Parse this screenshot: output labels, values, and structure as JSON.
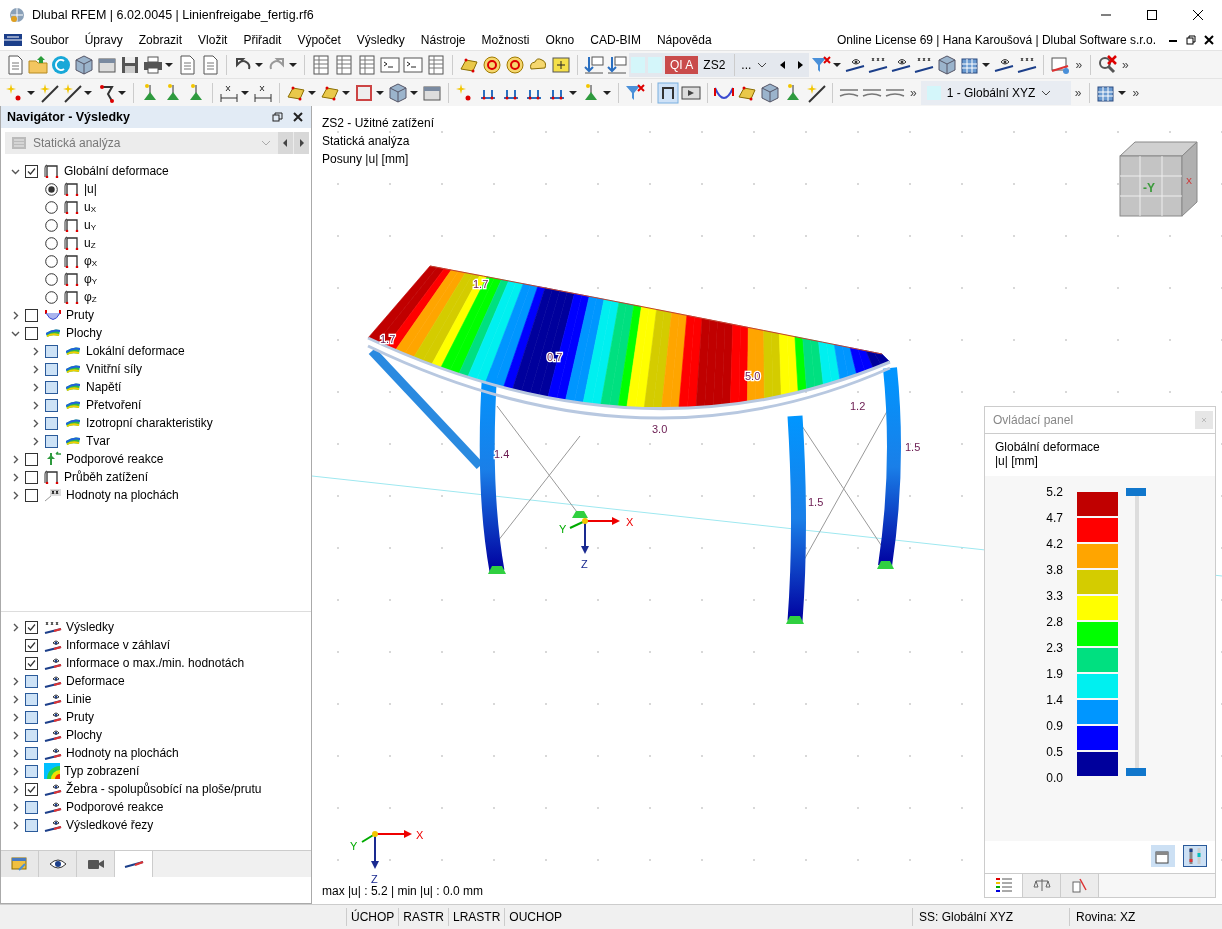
{
  "window": {
    "title": "Dlubal RFEM | 6.02.0045 | Linienfreigabe_fertig.rf6"
  },
  "menu": {
    "items": [
      "Soubor",
      "Úpravy",
      "Zobrazit",
      "Vložit",
      "Přiřadit",
      "Výpočet",
      "Výsledky",
      "Nástroje",
      "Možnosti",
      "Okno",
      "CAD-BIM",
      "Nápověda"
    ],
    "license": "Online License 69 | Hana Karoušová | Dlubal Software s.r.o."
  },
  "toolbar": {
    "load_case_tag": "QI A",
    "load_case": "ZS2",
    "load_case_more": "...",
    "coordinate_system": "1 - Globální XYZ",
    "overflow_top": [
      "»",
      "»"
    ],
    "overflow_bottom": [
      "»",
      "»",
      "»"
    ]
  },
  "navigator": {
    "title": "Navigátor - Výsledky",
    "analysis": "Statická analýza",
    "tree": [
      {
        "label": "Globální deformace",
        "kind": "check",
        "checked": true,
        "partial": false,
        "expanded": true,
        "children": [
          {
            "label": "|u|",
            "kind": "radio",
            "selected": true
          },
          {
            "label": "u$_{X}$",
            "kind": "radio",
            "selected": false
          },
          {
            "label": "u$_{Y}$",
            "kind": "radio",
            "selected": false
          },
          {
            "label": "u$_{Z}$",
            "kind": "radio",
            "selected": false
          },
          {
            "label": "φ$_{X}$",
            "kind": "radio",
            "selected": false
          },
          {
            "label": "φ$_{Y}$",
            "kind": "radio",
            "selected": false
          },
          {
            "label": "φ$_{Z}$",
            "kind": "radio",
            "selected": false
          }
        ]
      },
      {
        "label": "Pruty",
        "kind": "check",
        "checked": false,
        "partial": false,
        "expanded": false
      },
      {
        "label": "Plochy",
        "kind": "check",
        "checked": false,
        "partial": false,
        "expanded": true,
        "children": [
          {
            "label": "Lokální deformace",
            "kind": "check",
            "checked": false,
            "partial": true,
            "expanded": false
          },
          {
            "label": "Vnitřní síly",
            "kind": "check",
            "checked": false,
            "partial": true,
            "expanded": false
          },
          {
            "label": "Napětí",
            "kind": "check",
            "checked": false,
            "partial": true,
            "expanded": false
          },
          {
            "label": "Přetvoření",
            "kind": "check",
            "checked": false,
            "partial": true,
            "expanded": false
          },
          {
            "label": "Izotropní charakteristiky",
            "kind": "check",
            "checked": false,
            "partial": true,
            "expanded": false
          },
          {
            "label": "Tvar",
            "kind": "check",
            "checked": false,
            "partial": true,
            "expanded": false
          }
        ]
      },
      {
        "label": "Podporové reakce",
        "kind": "check",
        "checked": false,
        "partial": false,
        "expanded": false
      },
      {
        "label": "Průběh zatížení",
        "kind": "check",
        "checked": false,
        "partial": false,
        "expanded": false
      },
      {
        "label": "Hodnoty na plochách",
        "kind": "check",
        "checked": false,
        "partial": false,
        "expanded": false
      }
    ],
    "display_tree": [
      {
        "label": "Výsledky",
        "kind": "check",
        "checked": true,
        "partial": false,
        "expanded": false
      },
      {
        "label": "Informace v záhlaví",
        "kind": "check",
        "checked": true,
        "partial": false
      },
      {
        "label": "Informace o max./min. hodnotách",
        "kind": "check",
        "checked": true,
        "partial": false
      },
      {
        "label": "Deformace",
        "kind": "check",
        "checked": false,
        "partial": true,
        "expanded": false
      },
      {
        "label": "Linie",
        "kind": "check",
        "checked": false,
        "partial": true,
        "expanded": false
      },
      {
        "label": "Pruty",
        "kind": "check",
        "checked": false,
        "partial": true,
        "expanded": false
      },
      {
        "label": "Plochy",
        "kind": "check",
        "checked": false,
        "partial": true,
        "expanded": false
      },
      {
        "label": "Hodnoty na plochách",
        "kind": "check",
        "checked": false,
        "partial": true,
        "expanded": false
      },
      {
        "label": "Typ zobrazení",
        "kind": "check",
        "checked": false,
        "partial": true,
        "expanded": false
      },
      {
        "label": "Žebra - spolupůsobící na ploše/prutu",
        "kind": "check",
        "checked": true,
        "partial": false,
        "expanded": false
      },
      {
        "label": "Podporové reakce",
        "kind": "check",
        "checked": false,
        "partial": true,
        "expanded": false
      },
      {
        "label": "Výsledkové řezy",
        "kind": "check",
        "checked": false,
        "partial": true,
        "expanded": false
      }
    ],
    "tabs": [
      {
        "selected": false
      },
      {
        "selected": false
      },
      {
        "selected": false
      },
      {
        "selected": true
      }
    ]
  },
  "viewport": {
    "info": [
      "ZS2 - Užitné zatížení",
      "Statická analýza",
      "Posuny |u| [mm]"
    ],
    "value_labels": [
      "1.7",
      "1.7",
      "0.7",
      "5.0",
      "1.2",
      "3.0",
      "1.4",
      "1.5",
      "1.5"
    ],
    "axes": [
      "X",
      "Y",
      "Z"
    ],
    "mini_axes": [
      "X",
      "Y",
      "Z"
    ],
    "view_cube": [
      "-Y",
      "X"
    ],
    "summary": "max |u| : 5.2 | min |u| : 0.0 mm"
  },
  "control_panel": {
    "title": "Ovládací panel",
    "heading": "Globální deformace",
    "unit": "|u| [mm]",
    "legend": {
      "ticks": [
        "5.2",
        "4.7",
        "4.2",
        "3.8",
        "3.3",
        "2.8",
        "2.3",
        "1.9",
        "1.4",
        "0.9",
        "0.5",
        "0.0"
      ],
      "bands": [
        {
          "color": "#c00000"
        },
        {
          "color": "#ff0000"
        },
        {
          "color": "#ffa500"
        },
        {
          "color": "#d4cc00"
        },
        {
          "color": "#ffff00"
        },
        {
          "color": "#00ff00"
        },
        {
          "color": "#00e080"
        },
        {
          "color": "#00f0f0"
        },
        {
          "color": "#0096ff"
        },
        {
          "color": "#0000ff"
        },
        {
          "color": "#00009c"
        }
      ]
    },
    "scale_slider": {
      "level": 1
    },
    "tabs": [
      {
        "selected": true
      },
      {
        "selected": false
      },
      {
        "selected": false
      }
    ]
  },
  "status_bar": {
    "toggles": [
      "ÚCHOP",
      "RASTR",
      "LRASTR",
      "OUCHOP"
    ],
    "coordinate_system": "SS: Globální XYZ",
    "plane": "Rovina: XZ"
  }
}
